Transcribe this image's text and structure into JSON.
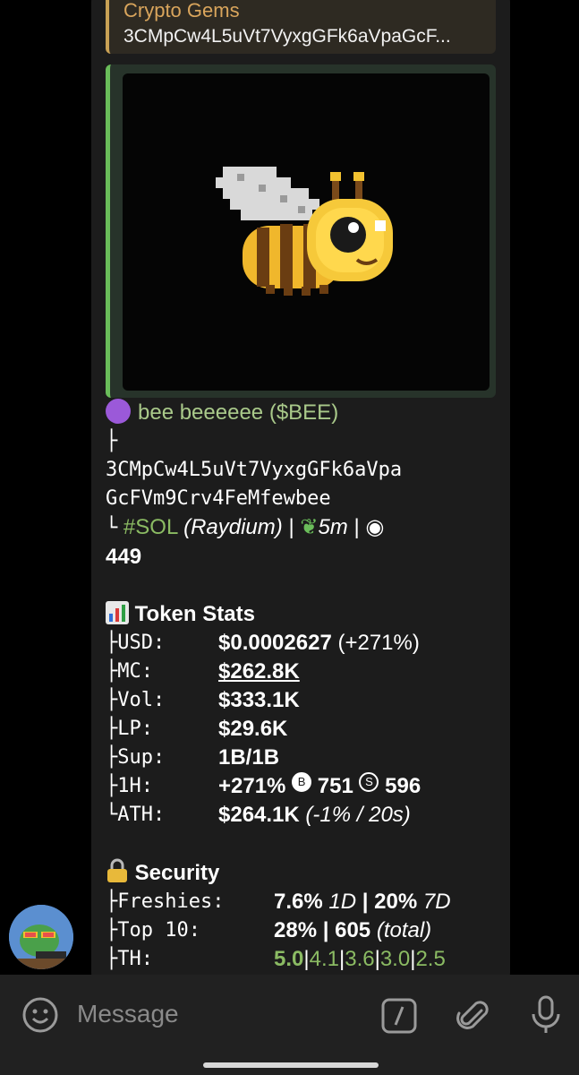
{
  "reply": {
    "title": "Crypto Gems",
    "text": "3CMpCw4L5uVt7VyxgGFk6aVpaGcF..."
  },
  "token": {
    "name": "bee beeeeee",
    "ticker": "($BEE)",
    "tree_top": "├",
    "address_line1": "3CMpCw4L5uVt7VyxgGFk6aVpa",
    "address_line2": "GcFVm9Crv4FeMfewbee",
    "tree_end": "└",
    "chain": "#SOL",
    "dex": "(Raydium)",
    "sep1": "|",
    "age": "5m",
    "sep2": "|",
    "views": "449"
  },
  "token_stats": {
    "heading": "Token Stats",
    "rows": [
      {
        "key": "├USD:",
        "value": "$0.0002627",
        "extra": "(+271%)"
      },
      {
        "key": "├MC:",
        "value": "$262.8K",
        "extra": ""
      },
      {
        "key": "├Vol:",
        "value": "$333.1K",
        "extra": ""
      },
      {
        "key": "├LP:",
        "value": "$29.6K",
        "extra": ""
      },
      {
        "key": "├Sup:",
        "value": "1B/1B",
        "extra": ""
      },
      {
        "key": "├1H:",
        "value": "+271%",
        "buys_icon": "B",
        "buys": "751",
        "sells_icon": "S",
        "sells": "596"
      },
      {
        "key": "└ATH:",
        "value": "$264.1K",
        "extra": "(-1% / 20s)"
      }
    ]
  },
  "security": {
    "heading": "Security",
    "rows": [
      {
        "key": "├Freshies:",
        "v1": "7.6%",
        "i1": "1D",
        "sep": "|",
        "v2": "20%",
        "i2": "7D"
      },
      {
        "key": "├Top 10:",
        "v1": "28%",
        "sep": "|",
        "v2": "605",
        "i2": "(total)"
      },
      {
        "key": "├TH:",
        "th": [
          "5.0",
          "4.1",
          "3.6",
          "3.0",
          "2.5"
        ]
      }
    ]
  },
  "composer": {
    "placeholder": "Message"
  },
  "icons": {
    "stats": "bar-chart-icon",
    "security": "lock-icon",
    "emoji": "emoji-icon",
    "command": "slash-command-icon",
    "attach": "paperclip-icon",
    "mic": "microphone-icon",
    "age": "seedling-icon",
    "views": "eye-icon"
  },
  "colors": {
    "bubble": "#1c1c1c",
    "accent_green": "#8bbb63",
    "reply_accent": "#c8a155",
    "preview_border": "#6abd5a"
  }
}
